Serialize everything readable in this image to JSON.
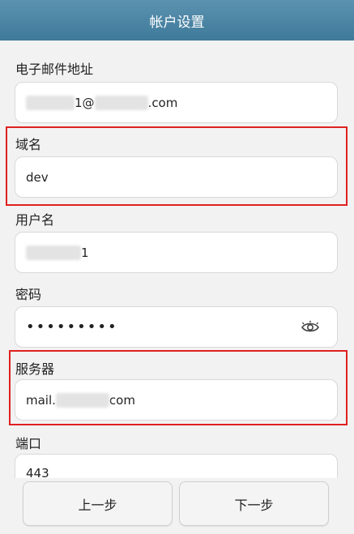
{
  "titlebar": {
    "title": "帐户设置"
  },
  "fields": {
    "email": {
      "label": "电子邮件地址",
      "value_prefix": "1@",
      "value_suffix": ".com"
    },
    "domain": {
      "label": "域名",
      "value": "dev"
    },
    "username": {
      "label": "用户名",
      "value_suffix": "1"
    },
    "password": {
      "label": "密码",
      "value": "•••••••••"
    },
    "server": {
      "label": "服务器",
      "value_prefix": "mail.",
      "value_suffix": "com"
    },
    "port": {
      "label": "端口",
      "value": "443"
    }
  },
  "buttons": {
    "prev": "上一步",
    "next": "下一步"
  },
  "icons": {
    "password_toggle": "eye-icon"
  },
  "colors": {
    "highlight": "#e02020",
    "titlebar": "#4a86a6"
  }
}
